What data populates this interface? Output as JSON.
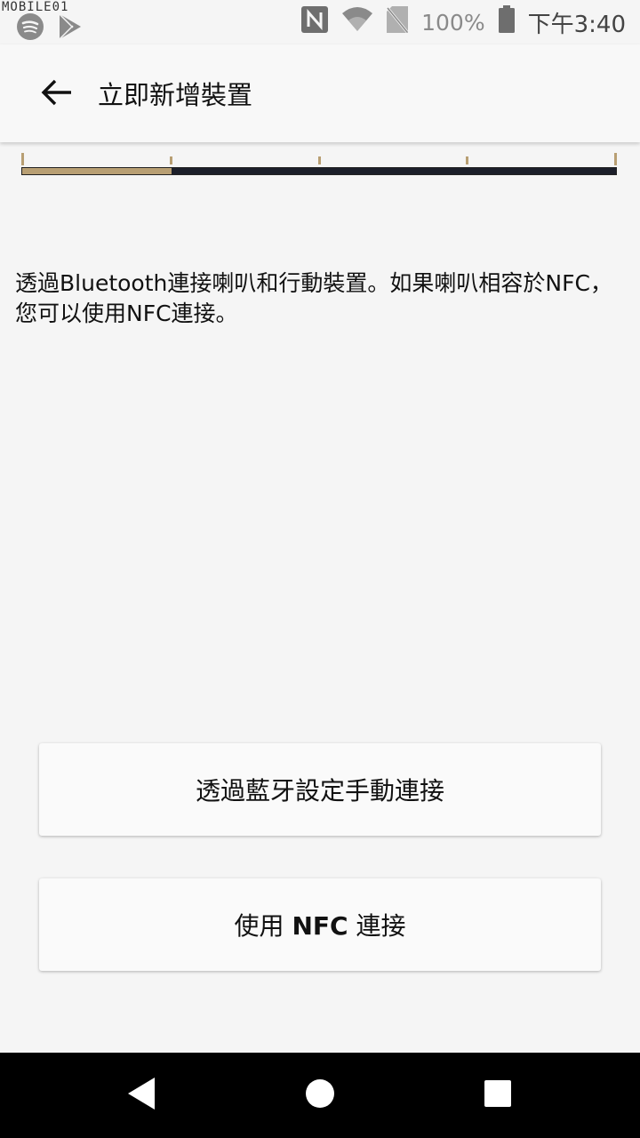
{
  "status_bar": {
    "watermark": "MOBILE01",
    "battery_text": "100%",
    "time": "下午3:40",
    "left_icons": [
      "spotify-icon",
      "play-store-icon"
    ],
    "right_icons": [
      "nfc-icon",
      "wifi-icon",
      "no-sim-icon",
      "battery-icon"
    ]
  },
  "app_bar": {
    "back_icon": "arrow-left-icon",
    "title": "立即新增裝置"
  },
  "progress": {
    "steps": 5,
    "current_step": 2,
    "fill_fraction": 0.25
  },
  "main": {
    "description": "透過Bluetooth連接喇叭和行動裝置。如果喇叭相容於NFC，您可以使用NFC連接。"
  },
  "buttons": {
    "bluetooth_label": "透過藍牙設定手動連接",
    "nfc_prefix": "使用 ",
    "nfc_bold": "NFC",
    "nfc_suffix": " 連接"
  },
  "nav_bar": {
    "icons": [
      "back-triangle-icon",
      "home-circle-icon",
      "recent-square-icon"
    ]
  },
  "colors": {
    "background": "#f5f5f5",
    "progress_fill": "#b89f73",
    "progress_track": "#1c1f2a",
    "nav_bar": "#000000"
  }
}
